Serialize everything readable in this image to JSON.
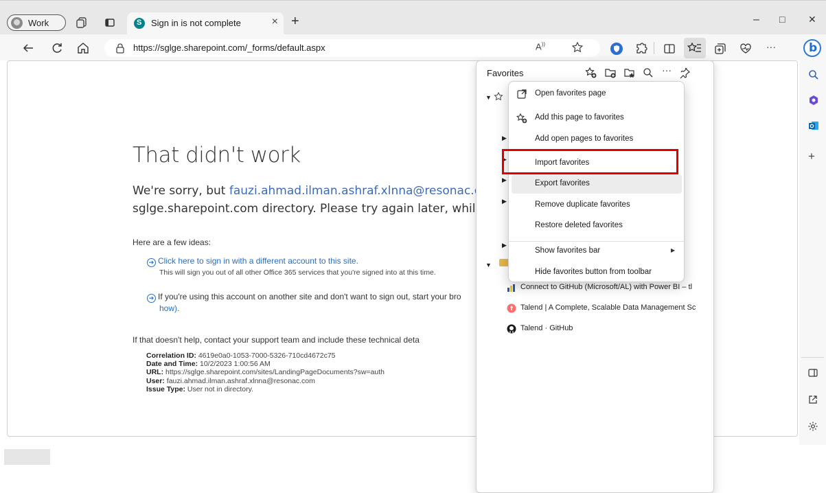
{
  "browser": {
    "profile_label": "Work",
    "tab_title": "Sign in is not complete",
    "tab_close": "×",
    "new_tab": "+",
    "url": "https://sglge.sharepoint.com/_forms/default.aspx",
    "window_controls": {
      "minimize": "–",
      "maximize": "□",
      "close": "✕"
    },
    "toolbar_more": "···"
  },
  "page": {
    "title": "That didn't work",
    "line1_prefix": "We're sorry, but ",
    "line1_email": "fauzi.ahmad.ilman.ashraf.xlnna@resonac.com",
    "line2": "sglge.sharepoint.com directory. Please try again later, while we",
    "ideas_heading": "Here are a few ideas:",
    "idea1_link": "Click here to sign in with a different account to this site.",
    "idea1_note": "This will sign you out of all other Office 365 services that you're signed into at this time.",
    "idea2_text": "If you're using this account on another site and don't want to sign out, start your bro",
    "idea2_cont": "how).",
    "support_line": "If that doesn't help, contact your support team and include these technical deta",
    "details": [
      {
        "label": "Correlation ID:",
        "value": "4619e0a0-1053-7000-5326-710cd4672c75"
      },
      {
        "label": "Date and Time:",
        "value": "10/2/2023 1:00:56 AM"
      },
      {
        "label": "URL:",
        "value": "https://sglge.sharepoint.com/sites/LandingPageDocuments?sw=auth"
      },
      {
        "label": "User:",
        "value": "fauzi.ahmad.ilman.ashraf.xlnna@resonac.com"
      },
      {
        "label": "Issue Type:",
        "value": "User not in directory."
      }
    ]
  },
  "favorites": {
    "title": "Favorites",
    "items": [
      {
        "label": "Connect to GitHub (Microsoft/AL) with Power BI – tl"
      },
      {
        "label": "Talend | A Complete, Scalable Data Management Sc"
      },
      {
        "label": "Talend · GitHub"
      }
    ]
  },
  "menu": {
    "items": [
      {
        "label": "Open favorites page"
      },
      {
        "label": "Add this page to favorites"
      },
      {
        "label": "Add open pages to favorites"
      },
      {
        "label": "Import favorites"
      },
      {
        "label": "Export favorites"
      },
      {
        "label": "Remove duplicate favorites"
      },
      {
        "label": "Restore deleted favorites"
      },
      {
        "label": "Show favorites bar"
      },
      {
        "label": "Hide favorites button from toolbar"
      }
    ],
    "highlighted": "Export favorites",
    "outlined": "Import favorites",
    "outline_color": "#e00000"
  },
  "colors": {
    "accent": "#2a6ebb",
    "sharepoint": "#038387",
    "talend": "#ff6d70"
  }
}
